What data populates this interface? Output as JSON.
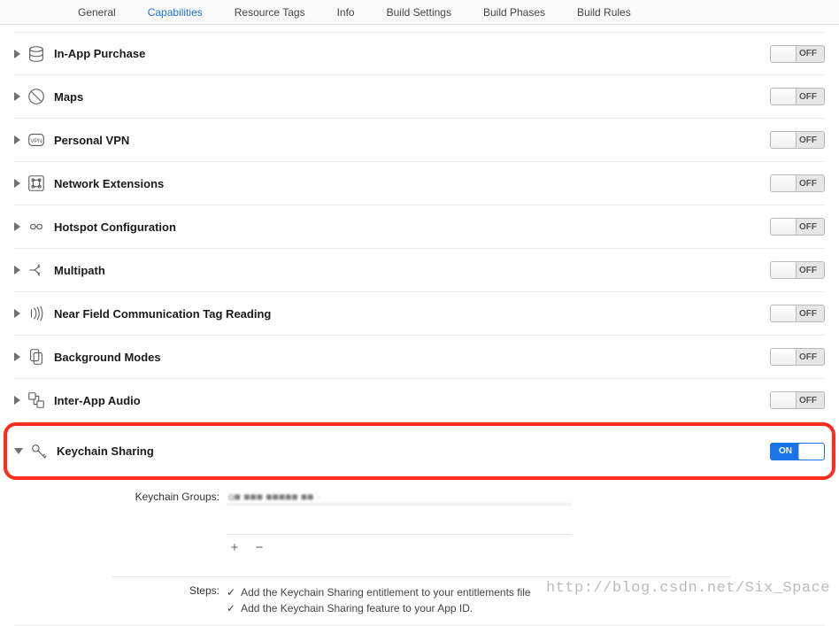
{
  "tabs": {
    "general": "General",
    "capabilities": "Capabilities",
    "resource_tags": "Resource Tags",
    "info": "Info",
    "build_settings": "Build Settings",
    "build_phases": "Build Phases",
    "build_rules": "Build Rules",
    "active": "capabilities"
  },
  "toggle_labels": {
    "on": "ON",
    "off": "OFF"
  },
  "capabilities": {
    "in_app_purchase": {
      "label": "In-App Purchase",
      "state": "off",
      "icon": "in-app-purchase-icon"
    },
    "maps": {
      "label": "Maps",
      "state": "off",
      "icon": "maps-icon"
    },
    "personal_vpn": {
      "label": "Personal VPN",
      "state": "off",
      "icon": "vpn-icon"
    },
    "network_extensions": {
      "label": "Network Extensions",
      "state": "off",
      "icon": "network-extensions-icon"
    },
    "hotspot": {
      "label": "Hotspot Configuration",
      "state": "off",
      "icon": "hotspot-icon"
    },
    "multipath": {
      "label": "Multipath",
      "state": "off",
      "icon": "multipath-icon"
    },
    "nfc": {
      "label": "Near Field Communication Tag Reading",
      "state": "off",
      "icon": "nfc-icon"
    },
    "background_modes": {
      "label": "Background Modes",
      "state": "off",
      "icon": "background-modes-icon"
    },
    "inter_app_audio": {
      "label": "Inter-App Audio",
      "state": "off",
      "icon": "inter-app-audio-icon"
    },
    "keychain_sharing": {
      "label": "Keychain Sharing",
      "state": "on",
      "icon": "keychain-icon",
      "expanded": true
    }
  },
  "keychain_detail": {
    "groups_label": "Keychain Groups:",
    "group_value": "o■ ■■■ ■■■■■ ■■ ·",
    "add_symbol": "+",
    "remove_symbol": "−",
    "steps_label": "Steps:",
    "steps": [
      "Add the Keychain Sharing entitlement to your entitlements file",
      "Add the Keychain Sharing feature to your App ID."
    ]
  },
  "watermark": "http://blog.csdn.net/Six_Space"
}
